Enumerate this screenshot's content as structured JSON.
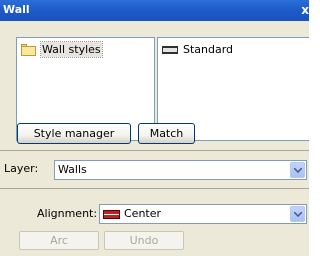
{
  "window": {
    "title": "Wall",
    "close_glyph": "x"
  },
  "styles": {
    "left_list": [
      {
        "label": "Wall styles",
        "icon": "folder-icon"
      }
    ],
    "right_list": [
      {
        "label": "Standard",
        "icon": "wall-style-icon"
      }
    ],
    "style_manager_label": "Style manager",
    "match_label": "Match"
  },
  "layer": {
    "label": "Layer:",
    "value": "Walls"
  },
  "alignment": {
    "label": "Alignment:",
    "value": "Center",
    "icon": "center-alignment-icon",
    "icon_color": "#c02020"
  },
  "actions": {
    "arc_label": "Arc",
    "undo_label": "Undo"
  },
  "colors": {
    "titlebar": "#1f5cc9",
    "panel": "#ece9d8",
    "border": "#7f9db9"
  }
}
